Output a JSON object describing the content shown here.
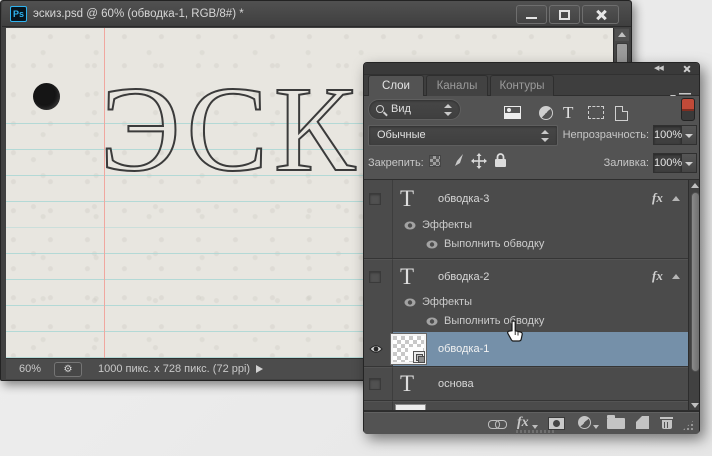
{
  "window": {
    "app_badge": "Ps",
    "title": "эскиз.psd @ 60% (обводка-1, RGB/8#) *"
  },
  "canvas": {
    "word": "ЭСКИЗ"
  },
  "statusbar": {
    "zoom": "60%",
    "doc_info": "1000 пикс. x 728 пикс. (72 ppi)",
    "gear_glyph": "⚙"
  },
  "panel": {
    "tabs": [
      "Слои",
      "Каналы",
      "Контуры"
    ],
    "filter_label": "Вид",
    "blend_mode": "Обычные",
    "opacity_label": "Непрозрачность:",
    "opacity_value": "100%",
    "lock_label": "Закрепить:",
    "fill_label": "Заливка:",
    "fill_value": "100%",
    "fx_label": "fx",
    "effects_label": "Эффекты",
    "effect_item_label": "Выполнить обводку",
    "collapse_glyph": "◀◀",
    "layers": [
      {
        "name": "обводка-3",
        "type": "text",
        "visible": false,
        "has_fx": true
      },
      {
        "name": "обводка-2",
        "type": "text",
        "visible": false,
        "has_fx": true
      },
      {
        "name": "обводка-1",
        "type": "image",
        "visible": true,
        "selected": true
      },
      {
        "name": "основа",
        "type": "text",
        "visible": false
      }
    ]
  },
  "colors": {
    "selection": "#7590a9",
    "filter_toggle_red": "#c14a38",
    "paper": "#e8e6e0",
    "rule_line": "#a9d6d4",
    "margin_line": "#f0a79f"
  }
}
